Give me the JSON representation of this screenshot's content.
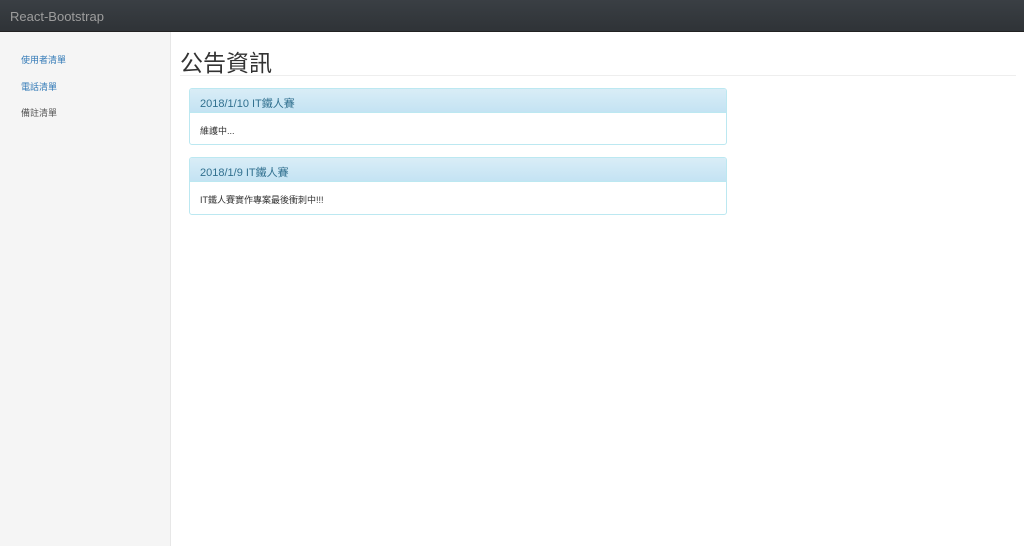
{
  "navbar": {
    "brand": "React-Bootstrap"
  },
  "sidebar": {
    "items": [
      {
        "label": "使用者清單"
      },
      {
        "label": "電話清單"
      },
      {
        "label": "備註清單"
      }
    ]
  },
  "main": {
    "title": "公告資訊",
    "announcements": [
      {
        "heading": "2018/1/10 IT鐵人賽",
        "body": "維護中..."
      },
      {
        "heading": "2018/1/9 IT鐵人賽",
        "body": "IT鐵人賽實作專案最後衝刺中!!!"
      }
    ]
  }
}
